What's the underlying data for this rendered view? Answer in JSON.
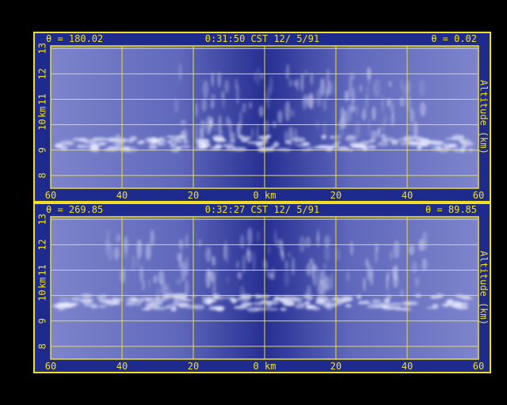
{
  "panels": [
    {
      "angle_left": "θ = 180.02",
      "timestamp": "0:31:50 CST 12/ 5/91",
      "angle_right": "θ = 0.02"
    },
    {
      "angle_left": "θ = 269.85",
      "timestamp": "0:32:27 CST 12/ 5/91",
      "angle_right": "θ = 89.85"
    }
  ],
  "chart_data": [
    {
      "type": "heatmap",
      "title": "0:31:50 CST 12/ 5/91",
      "xlabel": "0 km",
      "ylabel": "Altitude (km)",
      "ylabel_left": "km",
      "x_ticks": [
        "60",
        "40",
        "20",
        "0 km",
        "20",
        "40",
        "60"
      ],
      "y_ticks": [
        "8",
        "9",
        "10",
        "11",
        "12",
        "13"
      ],
      "xlim": [
        -60,
        60
      ],
      "ylim": [
        7.5,
        13.1
      ],
      "grid": true,
      "colors": {
        "background": "#1e2a8c",
        "grid": "#f0e020",
        "text": "#f0e020",
        "cloud": "#e8eaff"
      }
    },
    {
      "type": "heatmap",
      "title": "0:32:27 CST 12/ 5/91",
      "xlabel": "0 km",
      "ylabel": "Altitude (km)",
      "ylabel_left": "km",
      "x_ticks": [
        "60",
        "40",
        "20",
        "0 km",
        "20",
        "40",
        "60"
      ],
      "y_ticks": [
        "8",
        "9",
        "10",
        "11",
        "12",
        "13"
      ],
      "xlim": [
        -60,
        60
      ],
      "ylim": [
        7.5,
        13.1
      ],
      "grid": true,
      "colors": {
        "background": "#1e2a8c",
        "grid": "#f0e020",
        "text": "#f0e020",
        "cloud": "#e8eaff"
      }
    }
  ]
}
